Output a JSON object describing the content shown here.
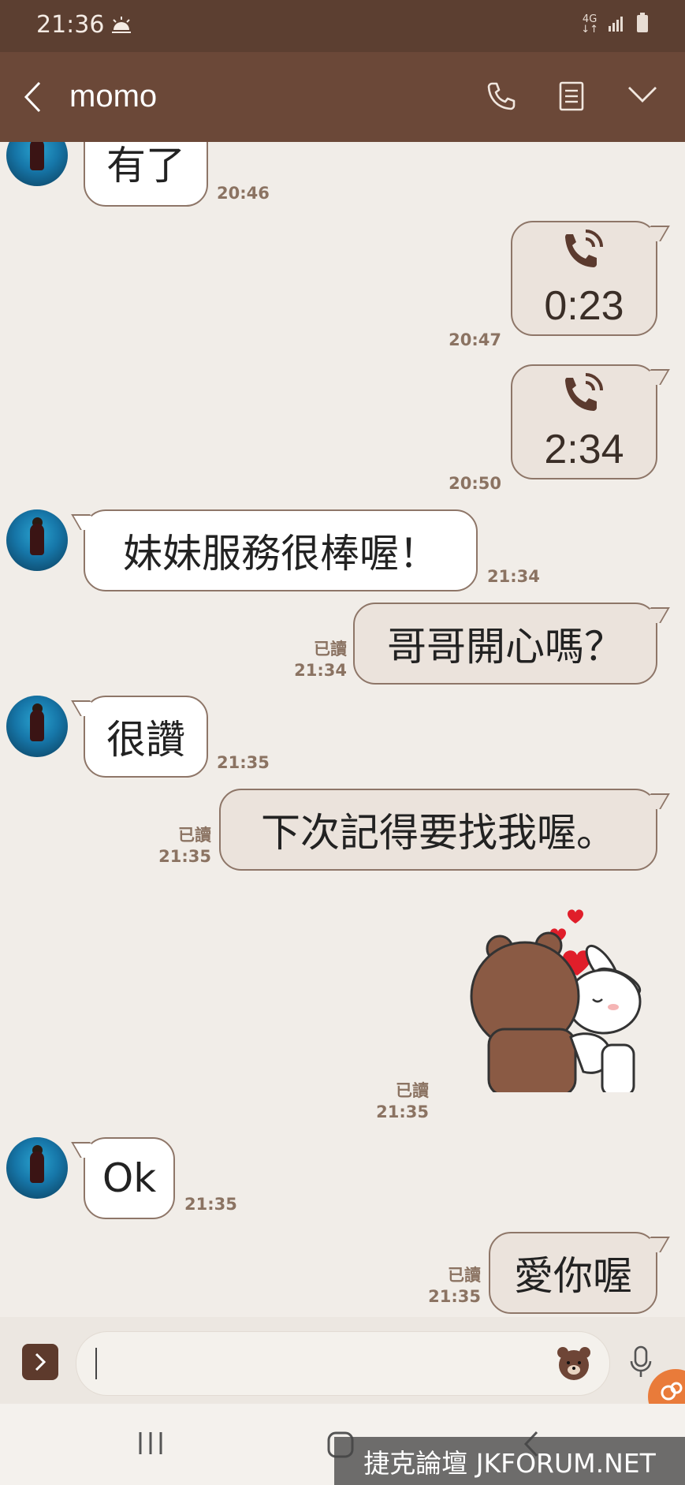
{
  "status_bar": {
    "time": "21:36",
    "network": "4G",
    "network_arrows": "↓↑"
  },
  "header": {
    "title": "momo"
  },
  "messages": [
    {
      "text": "有了",
      "time": "20:46"
    },
    {
      "duration": "0:23",
      "time": "20:47"
    },
    {
      "duration": "2:34",
      "time": "20:50"
    },
    {
      "text": "妹妹服務很棒喔！",
      "time": "21:34"
    },
    {
      "text": "哥哥開心嗎？",
      "read": "已讀",
      "time": "21:34"
    },
    {
      "text": "很讚",
      "time": "21:35"
    },
    {
      "text": "下次記得要找我喔。",
      "read": "已讀",
      "time": "21:35"
    },
    {
      "sticker": "bear-hug-bunny-sticker",
      "read": "已讀",
      "time": "21:35"
    },
    {
      "text": "Ok",
      "time": "21:35"
    },
    {
      "text": "愛你喔",
      "read": "已讀",
      "time": "21:35"
    }
  ],
  "watermark": "捷克論壇 JKFORUM.NET",
  "colors": {
    "header": "#6b4838",
    "status_bar": "#5c3f31",
    "background": "#f1ede8"
  }
}
